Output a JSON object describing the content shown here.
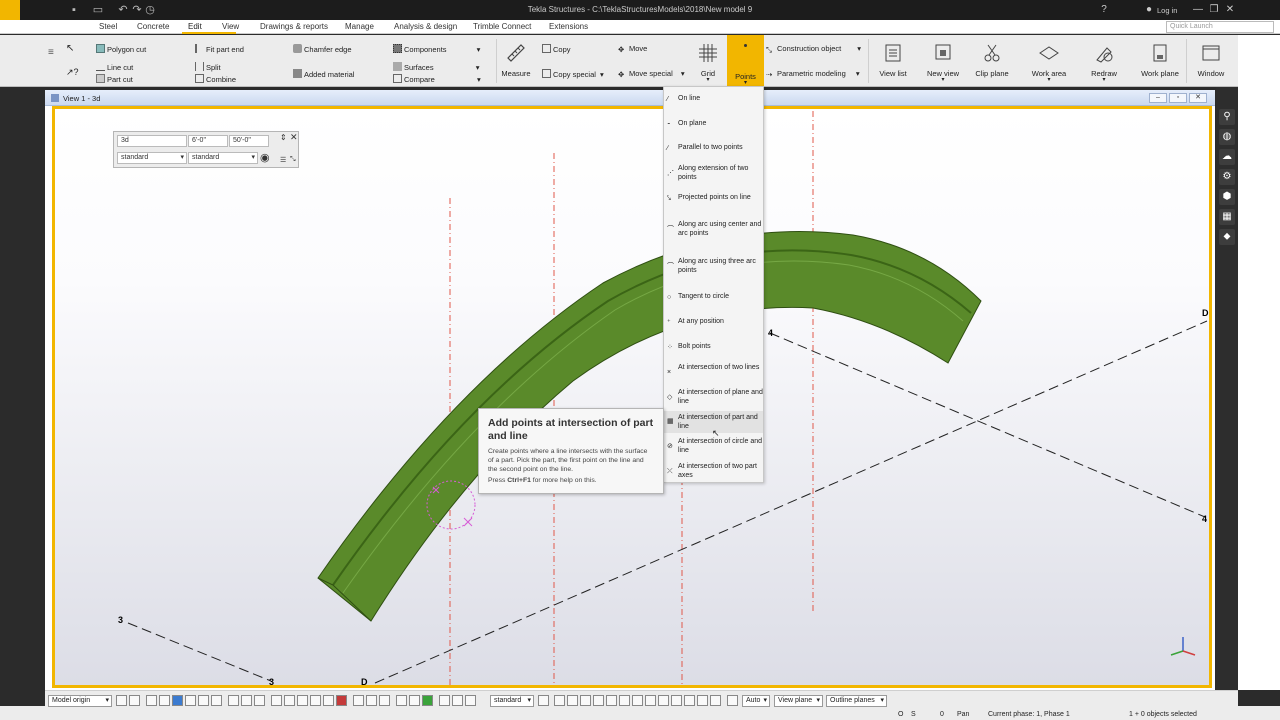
{
  "titlebar": {
    "title": "Tekla Structures - C:\\TeklaStructuresModels\\2018\\New model 9",
    "help": "?",
    "user_icon": "user-icon",
    "login": "Log in",
    "minimize": "—",
    "restore": "❐",
    "close": "✕"
  },
  "menu": {
    "tabs": [
      "Steel",
      "Concrete",
      "Edit",
      "View",
      "Drawings & reports",
      "Manage",
      "Analysis & design",
      "Trimble Connect",
      "Extensions"
    ],
    "active": "Edit",
    "quick_launch_placeholder": "Quick Launch"
  },
  "ribbon": {
    "polygon_cut": "Polygon cut",
    "line_cut": "Line cut",
    "part_cut": "Part cut",
    "fit_part_end": "Fit part end",
    "split": "Split",
    "combine": "Combine",
    "chamfer_edge": "Chamfer edge",
    "added_material": "Added material",
    "components": "Components",
    "surfaces": "Surfaces",
    "compare": "Compare",
    "measure": "Measure",
    "copy": "Copy",
    "copy_special": "Copy special",
    "move": "Move",
    "move_special": "Move special",
    "grid": "Grid",
    "points": "Points",
    "construction_object": "Construction object",
    "parametric_modeling": "Parametric modeling",
    "view_list": "View list",
    "new_view": "New view",
    "clip_plane": "Clip plane",
    "work_area": "Work area",
    "redraw": "Redraw",
    "work_plane": "Work plane",
    "window": "Window"
  },
  "view": {
    "title": "View 1 - 3d",
    "coord": {
      "field1": "3d",
      "field2": "6'-0\"",
      "field3": "50'-0\"",
      "sel1": "standard",
      "sel2": "standard"
    },
    "grid_labels": {
      "d_top": "D",
      "four_mid": "4",
      "four_right": "4",
      "three_left": "3",
      "three_bottom": "3",
      "d_bottom": "D"
    }
  },
  "points_menu": {
    "items": [
      "On line",
      "On plane",
      "Parallel to two points",
      "Along extension of two points",
      "Projected points on line",
      "Along arc using center and arc points",
      "Along arc using three arc points",
      "Tangent to circle",
      "At any position",
      "Bolt points",
      "At intersection of two lines",
      "At intersection of plane and line",
      "At intersection of part and line",
      "At intersection of circle and line",
      "At intersection of two part axes"
    ],
    "hovered": "At intersection of part and line"
  },
  "tooltip": {
    "title": "Add points at intersection of part and line",
    "description": "Create points where a line intersects with the surface of a part. Pick the part, the first point on the line and the second point on the line.",
    "help_prefix": "Press ",
    "help_key": "Ctrl+F1",
    "help_suffix": " for more help on this."
  },
  "statusbar": {
    "model_origin": "Model origin",
    "standard": "standard",
    "auto": "Auto",
    "view_plane": "View plane",
    "outline_planes": "Outline planes",
    "o_label": "O",
    "s_label": "S",
    "zero": "0",
    "pan": "Pan",
    "phase": "Current phase: 1, Phase 1",
    "selected": "1 + 0 objects selected"
  },
  "colors": {
    "accent": "#f2b600",
    "beam": "#5a8a2a",
    "gridline": "#e0584a"
  }
}
